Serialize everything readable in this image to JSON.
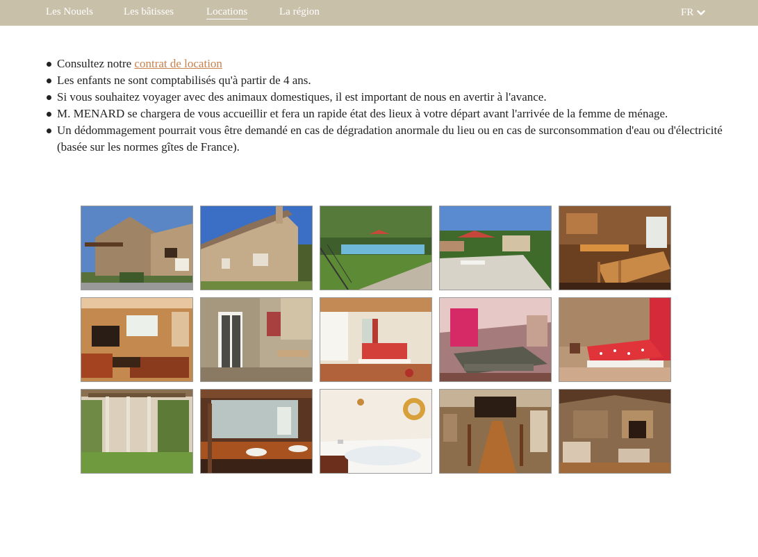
{
  "nav": {
    "items": [
      {
        "label": "Les Nouels"
      },
      {
        "label": "Les bâtisses"
      },
      {
        "label": "Locations"
      },
      {
        "label": "La région"
      }
    ],
    "language": "FR"
  },
  "info": {
    "item1_prefix": "Consultez notre ",
    "item1_link": "contrat de location",
    "item2": "Les enfants ne sont comptabilisés qu'à partir de 4 ans.",
    "item3": "Si vous souhaitez voyager avec des animaux domestiques, il est important de nous en avertir à l'avance.",
    "item4": "M. MENARD se chargera de vous accueillir et fera un rapide état des lieux à votre départ avant l'arrivée de la femme de ménage.",
    "item5": "Un dédommagement pourrait vous être demandé en cas de dégradation anormale du lieu ou en cas de surconsommation d'eau ou d'électricité (basée sur les normes gîtes de France)."
  },
  "gallery": {
    "photos": [
      {
        "subject": "stone house with wooden balcony"
      },
      {
        "subject": "stone house facade"
      },
      {
        "subject": "swimming pool with parasol"
      },
      {
        "subject": "terrace with parasol and lawn"
      },
      {
        "subject": "kitchen with dining table"
      },
      {
        "subject": "living room with sofas and fireplace"
      },
      {
        "subject": "stone wall with french window"
      },
      {
        "subject": "bedroom with red bed"
      },
      {
        "subject": "bedroom with pink curtains"
      },
      {
        "subject": "bedroom with red polka dot bed"
      },
      {
        "subject": "pergola in garden"
      },
      {
        "subject": "bathroom with double sink"
      },
      {
        "subject": "bathroom with jacuzzi bathtub"
      },
      {
        "subject": "long dining table hall"
      },
      {
        "subject": "lounge with fireplace"
      }
    ]
  }
}
